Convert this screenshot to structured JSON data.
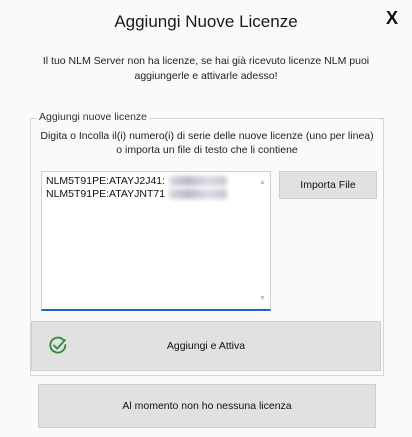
{
  "dialog": {
    "title": "Aggiungi Nuove Licenze",
    "close_glyph": "X",
    "intro_line1": "Il tuo NLM Server non ha licenze, se hai già ricevuto licenze NLM puoi",
    "intro_line2": "aggiungerle e attivarle adesso!"
  },
  "group": {
    "legend": "Aggiungi nuove licenze",
    "instr_line1": "Digita o Incolla il(i) numero(i) di serie delle nuove licenze (uno per linea)",
    "instr_line2": "o importa un file di testo che li contiene"
  },
  "licenses": [
    "NLM5T91PE:ATAYJ2J41:",
    "NLM5T91PE:ATAYJNT71"
  ],
  "buttons": {
    "import": "Importa File",
    "add_activate": "Aggiungi e Attiva",
    "no_license": "Al momento non ho nessuna licenza"
  },
  "icons": {
    "check": "check-circle-icon",
    "close": "close-icon",
    "scroll_up": "scroll-up-icon",
    "scroll_down": "scroll-down-icon"
  },
  "colors": {
    "accent": "#1e63c9",
    "check_green": "#2e8b3a"
  }
}
